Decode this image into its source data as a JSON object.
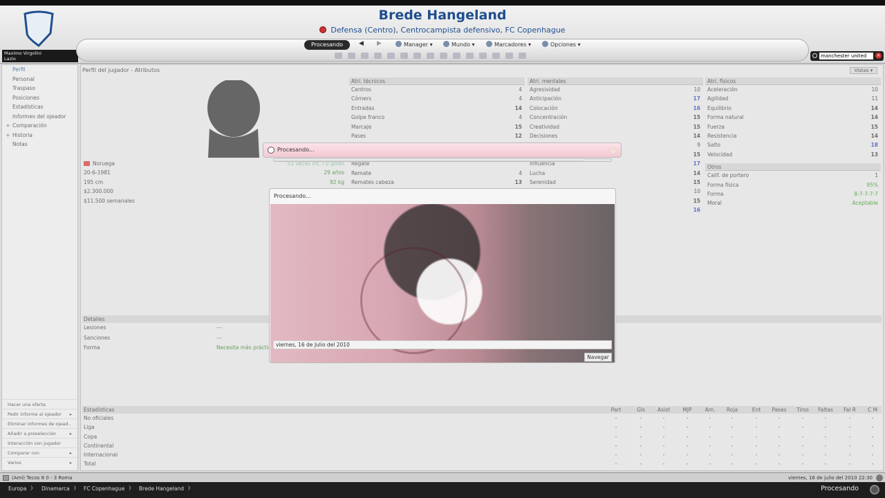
{
  "header": {
    "manager_name": "Maximo Virgolini",
    "manager_club": "Lazio",
    "player_name": "Brede Hangeland",
    "player_subtitle": "Defensa (Centro), Centrocampista defensivo, FC Copenhague",
    "processing_button": "Procesando",
    "menus": [
      "Manager",
      "Mundo",
      "Marcadores",
      "Opciones"
    ],
    "search_value": "manchester united"
  },
  "sidebar": {
    "items": [
      {
        "label": "Perfil",
        "active": true,
        "expandable": false
      },
      {
        "label": "Personal",
        "active": false,
        "expandable": false
      },
      {
        "label": "Traspaso",
        "active": false,
        "expandable": false
      },
      {
        "label": "Posiciones",
        "active": false,
        "expandable": false
      },
      {
        "label": "Estadísticas",
        "active": false,
        "expandable": false
      },
      {
        "label": "Informes del ojeador",
        "active": false,
        "expandable": false
      },
      {
        "label": "Comparación",
        "active": false,
        "expandable": true
      },
      {
        "label": "Historia",
        "active": false,
        "expandable": true
      },
      {
        "label": "Notas",
        "active": false,
        "expandable": false
      }
    ],
    "actions": [
      {
        "label": "Hacer una oferta",
        "arrow": false
      },
      {
        "label": "Pedir informe al ojeador",
        "arrow": true
      },
      {
        "label": "Eliminar informes de ojead..",
        "arrow": false
      },
      {
        "label": "Añadir a preselección",
        "arrow": true
      },
      {
        "label": "Interacción con jugador",
        "arrow": false
      },
      {
        "label": "Comparar con",
        "arrow": true
      },
      {
        "label": "Varios",
        "arrow": true
      }
    ]
  },
  "main": {
    "title": "Perfil del jugador - Atributos",
    "vistas": "Vistas",
    "info": {
      "nationality": "Noruega",
      "birth_date": "20-6-1981",
      "height": "195 cm",
      "value": "$2.300.000",
      "wage": "$11.500 semanales",
      "caps": "51 veces int. / 0 goles",
      "age": "29 años",
      "weight": "92 kg"
    },
    "technical": {
      "header": "Atri. técnicos",
      "rows": [
        {
          "name": "Centros",
          "value": "4",
          "style": ""
        },
        {
          "name": "Córners",
          "value": "4",
          "style": ""
        },
        {
          "name": "Entradas",
          "value": "14",
          "style": "hi"
        },
        {
          "name": "Golpe franco",
          "value": "4",
          "style": ""
        },
        {
          "name": "Marcaje",
          "value": "15",
          "style": "hi"
        },
        {
          "name": "Pases",
          "value": "12",
          "style": "hi"
        },
        {
          "name": "",
          "value": "",
          "style": ""
        },
        {
          "name": "",
          "value": "",
          "style": ""
        },
        {
          "name": "Regate",
          "value": "",
          "style": ""
        },
        {
          "name": "Remate",
          "value": "4",
          "style": ""
        },
        {
          "name": "Remates cabeza",
          "value": "13",
          "style": "hi"
        }
      ]
    },
    "mental": {
      "header": "Atri. mentales",
      "rows": [
        {
          "name": "Agresividad",
          "value": "10",
          "style": ""
        },
        {
          "name": "Anticipación",
          "value": "17",
          "style": "blue"
        },
        {
          "name": "Colocación",
          "value": "16",
          "style": "blue"
        },
        {
          "name": "Concentración",
          "value": "15",
          "style": "hi"
        },
        {
          "name": "Creatividad",
          "value": "15",
          "style": "hi"
        },
        {
          "name": "Decisiones",
          "value": "14",
          "style": "hi"
        },
        {
          "name": "",
          "value": "9",
          "style": ""
        },
        {
          "name": "",
          "value": "15",
          "style": "hi"
        },
        {
          "name": "Influencia",
          "value": "17",
          "style": "blue"
        },
        {
          "name": "Lucha",
          "value": "14",
          "style": "hi"
        },
        {
          "name": "Serenidad",
          "value": "15",
          "style": "hi"
        },
        {
          "name": "",
          "value": "10",
          "style": ""
        },
        {
          "name": "",
          "value": "15",
          "style": "hi"
        },
        {
          "name": "",
          "value": "16",
          "style": "blue"
        }
      ]
    },
    "physical": {
      "header": "Atri. físicos",
      "rows": [
        {
          "name": "Aceleración",
          "value": "10",
          "style": ""
        },
        {
          "name": "Agilidad",
          "value": "11",
          "style": ""
        },
        {
          "name": "Equilibrio",
          "value": "14",
          "style": "hi"
        },
        {
          "name": "Forma natural",
          "value": "14",
          "style": "hi"
        },
        {
          "name": "Fuerza",
          "value": "15",
          "style": "hi"
        },
        {
          "name": "Resistencia",
          "value": "14",
          "style": "hi"
        },
        {
          "name": "Salto",
          "value": "18",
          "style": "blue"
        },
        {
          "name": "Velocidad",
          "value": "13",
          "style": "hi"
        }
      ]
    },
    "others": {
      "header": "Otros",
      "rows": [
        {
          "name": "Calif. de portero",
          "value": "1",
          "style": ""
        },
        {
          "name": "Forma física",
          "value": "95%",
          "style": "green"
        },
        {
          "name": "Forma",
          "value": "8-7-7-7-7",
          "style": "green"
        },
        {
          "name": "Moral",
          "value": "Aceptable",
          "style": "green"
        }
      ]
    },
    "details": {
      "header": "Detalles",
      "rows": [
        {
          "name": "Lesiones",
          "value": "---"
        },
        {
          "name": "Sanciones",
          "value": "---"
        },
        {
          "name": "Forma",
          "value": "Necesita más práctica"
        }
      ]
    },
    "stats": {
      "header": "Estadísticas",
      "columns": [
        "Part",
        "Gls",
        "Asist",
        "MJP",
        "Am.",
        "Roja",
        "Ent",
        "Pases",
        "Tiros",
        "Faltas",
        "Fal R",
        "C M"
      ],
      "rows": [
        "No oficiales",
        "Liga",
        "Copa",
        "Continental",
        "Internacional",
        "Total"
      ],
      "dash": "-"
    }
  },
  "statusbar": {
    "ticker": "(Ami) Tecos 8 0 - 3 Roma",
    "datetime": "viernes, 16 de julio del 2010 22:30"
  },
  "breadcrumbs": [
    "Europa",
    "Dinamarca",
    "FC Copenhague",
    "Brede Hangeland"
  ],
  "breadcrumb_status": "Procesando",
  "dialog_small": {
    "title": "Procesando...",
    "progress": 0.92
  },
  "dialog_big": {
    "title": "Procesando...",
    "date": "viernes, 16 de Julio del 2010",
    "button": "Navegar"
  }
}
